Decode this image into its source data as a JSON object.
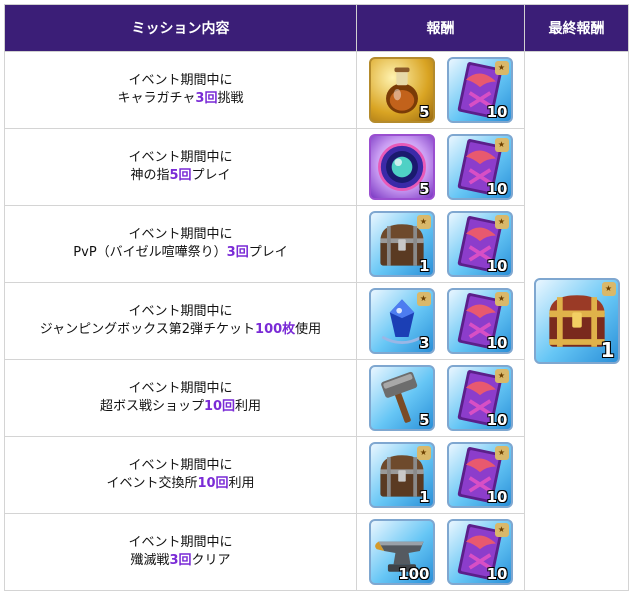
{
  "header": {
    "mission": "ミッション内容",
    "reward": "報酬",
    "final_reward": "最終報酬"
  },
  "rows": [
    {
      "line1": "イベント期間中に",
      "pre": "キャラガチャ",
      "hl": "3回",
      "post": "挑戦",
      "reward_a": {
        "icon": "potion-icon",
        "qty": "5"
      },
      "reward_b": {
        "icon": "ticket-icon",
        "qty": "10"
      }
    },
    {
      "line1": "イベント期間中に",
      "pre": "神の指",
      "hl": "5回",
      "post": "プレイ",
      "reward_a": {
        "icon": "orb-icon",
        "qty": "5"
      },
      "reward_b": {
        "icon": "ticket-icon",
        "qty": "10"
      }
    },
    {
      "line1": "イベント期間中に",
      "pre": "PvP（バイゼル喧嘩祭り）",
      "hl": "3回",
      "post": "プレイ",
      "reward_a": {
        "icon": "chest-icon",
        "qty": "1"
      },
      "reward_b": {
        "icon": "ticket-icon",
        "qty": "10"
      }
    },
    {
      "line1": "イベント期間中に",
      "pre": "ジャンピングボックス第2弾チケット",
      "hl": "100枚",
      "post": "使用",
      "reward_a": {
        "icon": "jewel-icon",
        "qty": "3"
      },
      "reward_b": {
        "icon": "ticket-icon",
        "qty": "10"
      }
    },
    {
      "line1": "イベント期間中に",
      "pre": "超ボス戦ショップ",
      "hl": "10回",
      "post": "利用",
      "reward_a": {
        "icon": "hammer-icon",
        "qty": "5"
      },
      "reward_b": {
        "icon": "ticket-icon",
        "qty": "10"
      }
    },
    {
      "line1": "イベント期間中に",
      "pre": "イベント交換所",
      "hl": "10回",
      "post": "利用",
      "reward_a": {
        "icon": "chest-icon",
        "qty": "1"
      },
      "reward_b": {
        "icon": "ticket-icon",
        "qty": "10"
      }
    },
    {
      "line1": "イベント期間中に",
      "pre": "殲滅戦",
      "hl": "3回",
      "post": "クリア",
      "reward_a": {
        "icon": "anvil-icon",
        "qty": "100"
      },
      "reward_b": {
        "icon": "ticket-icon",
        "qty": "10"
      }
    }
  ],
  "final": {
    "icon": "treasure-chest-icon",
    "qty": "1"
  },
  "colors": {
    "header_bg": "#3b1e77",
    "highlight": "#7a2bd6"
  }
}
